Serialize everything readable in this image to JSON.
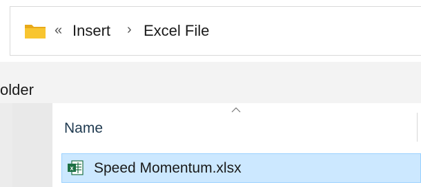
{
  "address_bar": {
    "overflow_glyph": "«",
    "breadcrumbs": [
      "Insert",
      "Excel File"
    ],
    "separator": "›"
  },
  "navigation_pane": {
    "title": "older"
  },
  "file_list": {
    "columns": [
      "Name"
    ],
    "sorted_column": "Name",
    "files": [
      {
        "name": "Speed Momentum.xlsx",
        "type_icon": "excel-file-icon",
        "selected": true
      }
    ]
  },
  "colors": {
    "selection_background": "#cce8ff",
    "selection_border": "#99d1ff",
    "folder_yellow": "#f8c530",
    "excel_green": "#1d7044"
  }
}
